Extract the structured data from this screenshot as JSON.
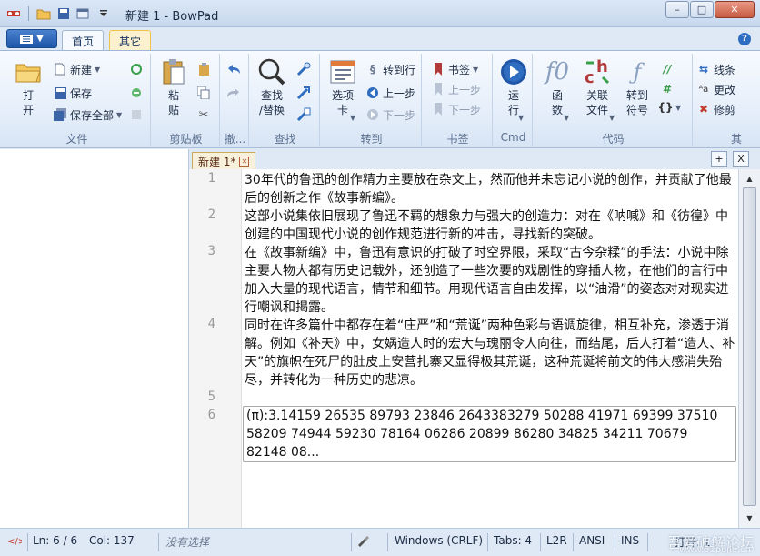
{
  "window": {
    "title": "新建 1 - BowPad",
    "controls": {
      "minimize": "–",
      "maximize": "□",
      "close": "✕"
    }
  },
  "ribbon_tabs": [
    {
      "label": "首页"
    },
    {
      "label": "其它"
    }
  ],
  "help": "?",
  "groups": {
    "file": {
      "label": "文件",
      "open": "打\n开",
      "new": "新建",
      "save": "保存",
      "save_all": "保存全部"
    },
    "clipboard": {
      "label": "剪贴板",
      "paste": "粘\n贴"
    },
    "undo": {
      "label": "撤..."
    },
    "find": {
      "label": "查找",
      "find_replace": "查找\n/替换"
    },
    "goto": {
      "label": "转到",
      "tabs": "选项\n卡",
      "goto_line": "转到行",
      "prev": "上一步",
      "next": "下一步"
    },
    "bookmarks": {
      "label": "书签",
      "bookmark": "书签",
      "prev": "上一步",
      "next": "下一步"
    },
    "cmd": {
      "label": "Cmd",
      "run": "运\n行"
    },
    "code": {
      "label": "代码",
      "functions": "函\n数",
      "related_files": "关联\n文件",
      "goto_symbol": "转到\n符号"
    },
    "other": {
      "label": "其",
      "linetype": "线条",
      "change": "更改",
      "trim": "修剪"
    }
  },
  "doc_tab": {
    "label": "新建 1*",
    "add": "+",
    "close_all": "X"
  },
  "editor": {
    "lines": [
      {
        "num": "1",
        "text": "30年代的鲁迅的创作精力主要放在杂文上，然而他并未忘记小说的创作，并贡献了他最后的创新之作《故事新编》。"
      },
      {
        "num": "2",
        "text": "这部小说集依旧展现了鲁迅不羁的想象力与强大的创造力：对在《呐喊》和《彷徨》中创建的中国现代小说的创作规范进行新的冲击，寻找新的突破。"
      },
      {
        "num": "3",
        "text": "在《故事新编》中，鲁迅有意识的打破了时空界限，采取“古今杂糅”的手法：小说中除主要人物大都有历史记载外，还创造了一些次要的戏剧性的穿插人物，在他们的言行中加入大量的现代语言，情节和细节。用现代语言自由发挥，以“油滑”的姿态对对现实进行嘲讽和揭露。"
      },
      {
        "num": "4",
        "text": "同时在许多篇什中都存在着“庄严”和“荒诞”两种色彩与语调旋律，相互补充，渗透于消解。例如《补天》中，女娲造人时的宏大与瑰丽令人向往，而结尾，后人打着“造人、补天”的旗帜在死尸的肚皮上安营扎寨又显得极其荒诞，这种荒诞将前文的伟大感消失殆尽，并转化为一种历史的悲凉。"
      },
      {
        "num": "5",
        "text": ""
      },
      {
        "num": "6",
        "text": "(π):3.14159 26535 89793 23846 2643383279 50288 41971 69399 37510 58209 74944 59230 78164 06286 20899 86280 34825 34211 70679 82148 08..."
      }
    ]
  },
  "status": {
    "ln": "Ln: 6 / 6",
    "col": "Col: 137",
    "selection": "没有选择",
    "eol": "Windows (CRLF)",
    "tabs": "Tabs: 4",
    "direction": "L2R",
    "encoding": "ANSI",
    "mode": "INS",
    "open": "打开: 1",
    "watermark": "吾爱破解论坛",
    "watermark_url": "www.52pojie.cn"
  },
  "colors": {
    "accent": "#2f6dc0",
    "ribbon_bg": "#e3edf9",
    "doc_tab_bg": "#f7f1dc"
  }
}
